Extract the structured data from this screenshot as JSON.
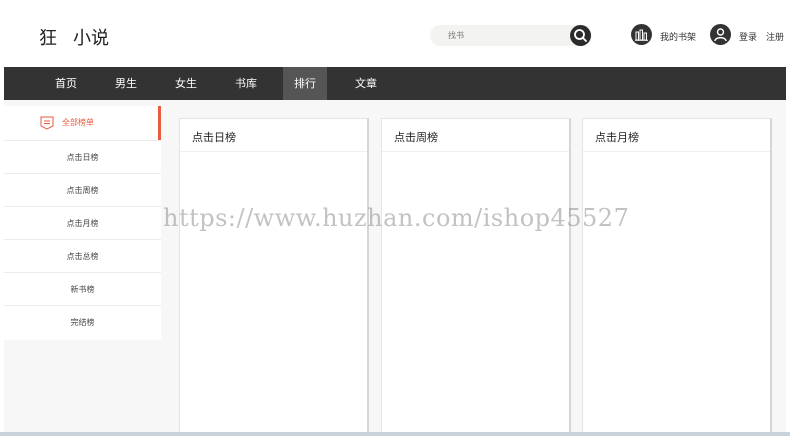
{
  "header": {
    "logo_part1": "狂",
    "logo_part2": "小说",
    "search_placeholder": "找书",
    "shelf_label": "我的书架",
    "login_label": "登录",
    "register_label": "注册"
  },
  "nav": {
    "items": [
      "首页",
      "男生",
      "女生",
      "书库",
      "排行",
      "文章"
    ],
    "active_index": 4
  },
  "sidebar": {
    "head_label": "全部榜单",
    "items": [
      "点击日榜",
      "点击周榜",
      "点击月榜",
      "点击总榜",
      "新书榜",
      "完结榜"
    ]
  },
  "panels": [
    "点击日榜",
    "点击周榜",
    "点击月榜"
  ],
  "watermark": "https://www.huzhan.com/ishop45527",
  "colors": {
    "accent": "#ea5a41",
    "nav_bg": "#333333",
    "nav_active": "#555555"
  }
}
